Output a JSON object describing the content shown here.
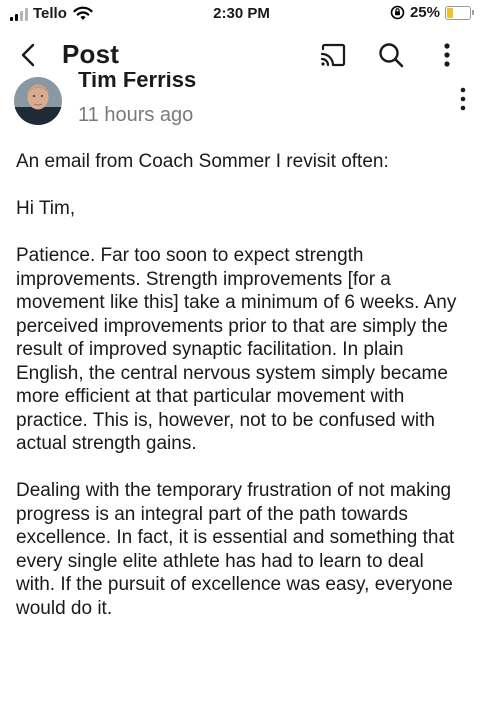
{
  "status_bar": {
    "carrier": "Tello",
    "time": "2:30 PM",
    "battery_percent": "25%",
    "battery_level": 0.25,
    "battery_color": "#f1c12b"
  },
  "nav": {
    "title": "Post",
    "back_icon": "chevron-left-icon",
    "cast_icon": "cast-icon",
    "search_icon": "search-icon",
    "more_icon": "more-vertical-icon"
  },
  "post": {
    "author": "Tim Ferriss",
    "time_ago": "11 hours ago",
    "paragraphs": [
      "An email from Coach Sommer I revisit often:",
      "Hi Tim,",
      "Patience. Far too soon to expect strength improvements. Strength improvements [for a movement like this] take a minimum of 6 weeks. Any perceived improvements prior to that are simply the result of improved synaptic facilitation. In plain English, the central nervous system simply became more efficient at that particular movement with practice. This is, however, not to be confused with actual strength gains.",
      "Dealing with the temporary frustration of not making progress is an integral part of the path towards excellence. In fact, it is essential and something that every single elite athlete has had to learn to deal with. If the pursuit of excellence was easy, everyone would do it."
    ]
  }
}
